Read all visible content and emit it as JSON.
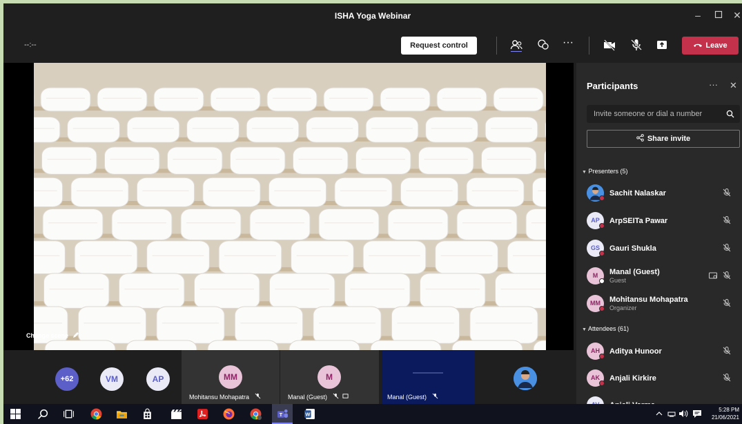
{
  "window": {
    "title": "ISHA Yoga Webinar"
  },
  "toolbar": {
    "timer": "--:--",
    "request_control": "Request control",
    "leave": "Leave"
  },
  "stage": {
    "change_scene": "Change scene"
  },
  "strip": {
    "overflow_count": "+62",
    "tiles": [
      {
        "initials": "VM",
        "name": ""
      },
      {
        "initials": "AP",
        "name": ""
      },
      {
        "initials": "MM",
        "name": "Mohitansu Mohapatra"
      },
      {
        "initials": "M",
        "name": "Manal (Guest)"
      },
      {
        "initials": "",
        "name": "Manal (Guest)"
      }
    ]
  },
  "panel": {
    "title": "Participants",
    "search_placeholder": "Invite someone or dial a number",
    "share_invite": "Share invite",
    "presenters_label": "Presenters (5)",
    "attendees_label": "Attendees (61)",
    "presenters": [
      {
        "initials": "",
        "name": "Sachit Nalaskar",
        "role": ""
      },
      {
        "initials": "AP",
        "name": "ArpSEITa Pawar",
        "role": ""
      },
      {
        "initials": "GS",
        "name": "Gauri Shukla",
        "role": ""
      },
      {
        "initials": "M",
        "name": "Manal (Guest)",
        "role": "Guest"
      },
      {
        "initials": "MM",
        "name": "Mohitansu Mohapatra",
        "role": "Organizer"
      }
    ],
    "attendees": [
      {
        "initials": "AH",
        "name": "Aditya Hunoor",
        "role": ""
      },
      {
        "initials": "AK",
        "name": "Anjali Kirkire",
        "role": ""
      },
      {
        "initials": "AV",
        "name": "Anjali Varma",
        "role": ""
      }
    ]
  },
  "taskbar": {
    "time": "5:28 PM",
    "date": "21/06/2021"
  },
  "colors": {
    "leave": "#c4314b",
    "avatar_purple_bg": "#5b5fc7",
    "avatar_pink_bg": "#e9c3d8",
    "avatar_pink_fg": "#8e2465",
    "frame_green": "#c8dcb4"
  }
}
